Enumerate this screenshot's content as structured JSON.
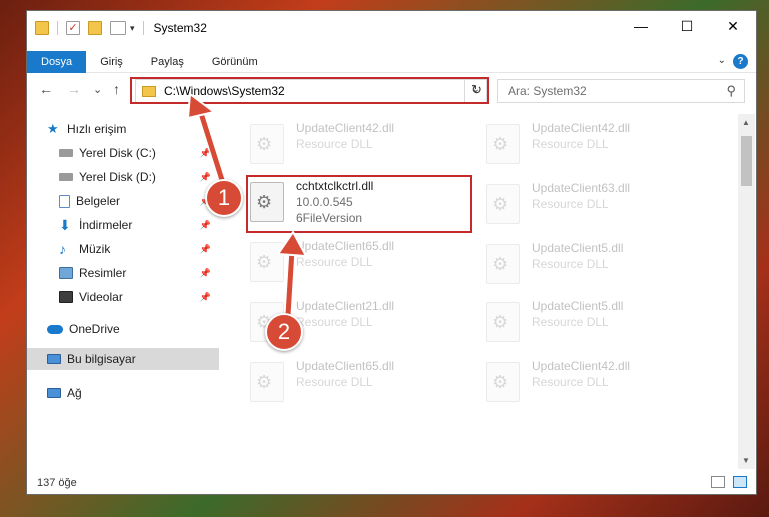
{
  "window": {
    "title": "System32",
    "controls": {
      "minimize": "—",
      "maximize": "☐",
      "close": "✕"
    }
  },
  "ribbon": {
    "tabs": [
      "Dosya",
      "Giriş",
      "Paylaş",
      "Görünüm"
    ],
    "active_tab": "Dosya",
    "help": "?"
  },
  "nav": {
    "back": "←",
    "forward": "→",
    "recent": "⌄",
    "up": "↑",
    "address": "C:\\Windows\\System32",
    "refresh": "↻",
    "search_placeholder": "Ara: System32"
  },
  "sidebar": {
    "items": [
      {
        "label": "Hızlı erişim",
        "icon": "star-icon",
        "pinned": false
      },
      {
        "label": "Yerel Disk (C:)",
        "icon": "drive-icon",
        "pinned": true
      },
      {
        "label": "Yerel Disk (D:)",
        "icon": "drive-icon",
        "pinned": true
      },
      {
        "label": "Belgeler",
        "icon": "document-icon",
        "pinned": true
      },
      {
        "label": "İndirmeler",
        "icon": "download-icon",
        "pinned": true
      },
      {
        "label": "Müzik",
        "icon": "music-icon",
        "pinned": true
      },
      {
        "label": "Resimler",
        "icon": "pictures-icon",
        "pinned": true
      },
      {
        "label": "Videolar",
        "icon": "video-icon",
        "pinned": true
      },
      {
        "label": "OneDrive",
        "icon": "cloud-icon",
        "pinned": false
      },
      {
        "label": "Bu bilgisayar",
        "icon": "computer-icon",
        "pinned": false,
        "selected": true
      },
      {
        "label": "Ağ",
        "icon": "network-icon",
        "pinned": false
      }
    ]
  },
  "files": {
    "highlighted": {
      "name": "cchtxtclkctrl.dll",
      "version": "10.0.0.545",
      "type": "6FileVersion"
    },
    "left_column": [
      {
        "name": "UpdateClient42.dll",
        "type": "Resource DLL"
      },
      {
        "name": "UpdateClient65.dll",
        "type": "Resource DLL"
      },
      {
        "name": "UpdateClient21.dll",
        "type": "Resource DLL"
      },
      {
        "name": "UpdateClient65.dll",
        "type": "Resource DLL"
      }
    ],
    "right_column": [
      {
        "name": "UpdateClient42.dll",
        "type": "Resource DLL"
      },
      {
        "name": "UpdateClient63.dll",
        "type": "Resource DLL"
      },
      {
        "name": "UpdateClient5.dll",
        "type": "Resource DLL"
      },
      {
        "name": "UpdateClient5.dll",
        "type": "Resource DLL"
      },
      {
        "name": "UpdateClient42.dll",
        "type": "Resource DLL"
      }
    ]
  },
  "status": {
    "count": "137 öğe"
  },
  "callouts": {
    "one": "1",
    "two": "2"
  },
  "colors": {
    "accent": "#1979ca",
    "highlight": "#c52a2a",
    "badge": "#d64a36"
  }
}
